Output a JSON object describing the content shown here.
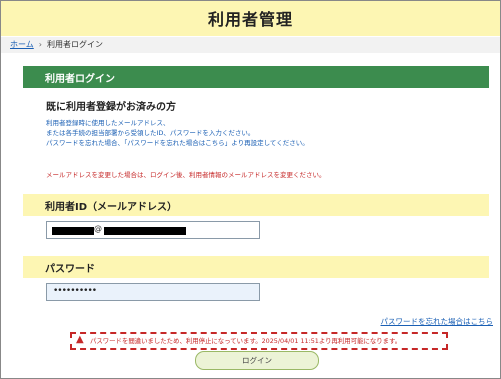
{
  "header": {
    "title": "利用者管理"
  },
  "breadcrumb": {
    "home": "ホーム",
    "separator": "›",
    "current": "利用者ログイン"
  },
  "panel": {
    "title": "利用者ログイン",
    "heading": "既に利用者登録がお済みの方",
    "info_lines": [
      "利用者登録時に使用したメールアドレス、",
      "または各手続の担当部署から受領したID、パスワードを入力ください。",
      "パスワードを忘れた場合、「パスワードを忘れた場合はこちら」より再設定してください。"
    ],
    "warning": "メールアドレスを変更した場合は、ログイン後、利用者情報のメールアドレスを変更ください。"
  },
  "userid": {
    "label": "利用者ID（メールアドレス）",
    "at_sign": "@"
  },
  "password": {
    "label": "パスワード",
    "masked_value": "••••••••••"
  },
  "forgot_link": "パスワードを忘れた場合はこちら",
  "error": {
    "icon": "warning-triangle-icon",
    "message": "パスワードを間違いましたため、利用停止になっています。2025/04/01 11:51より再利用可能になります。"
  },
  "login_button": "ログイン",
  "colors": {
    "header_bg": "#fdf6b3",
    "panel_head": "#3c8c4e",
    "link": "#1a5fb4",
    "error": "#c62828"
  }
}
